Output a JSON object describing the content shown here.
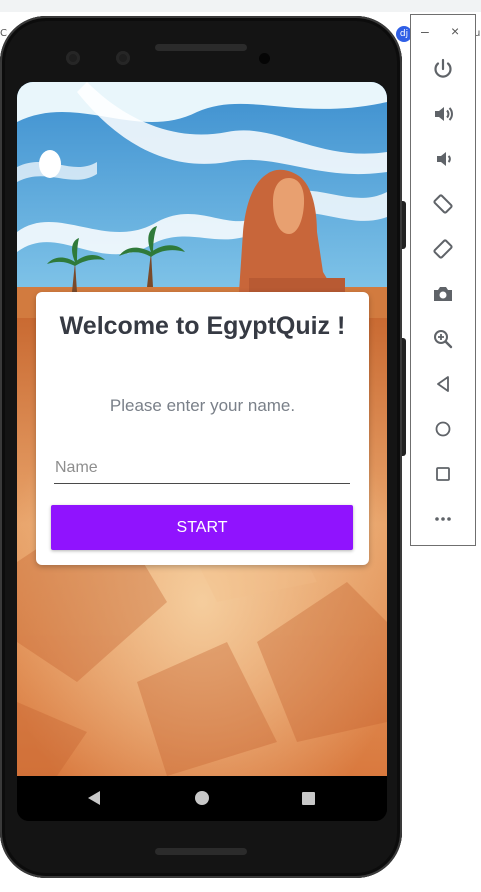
{
  "card": {
    "title": "Welcome to EgyptQuiz !",
    "subtitle": "Please enter your name.",
    "name_placeholder": "Name",
    "start_label": "START"
  },
  "panel": {
    "minimize": "–",
    "close": "×",
    "icons": [
      "power-icon",
      "volume-up-icon",
      "volume-down-icon",
      "rotate-left-icon",
      "rotate-right-icon",
      "camera-icon",
      "zoom-icon",
      "back-icon",
      "home-icon",
      "overview-icon",
      "more-icon"
    ]
  },
  "badge": "dj",
  "edge_left": "C",
  "edge_right": "u",
  "colors": {
    "start_button": "#9013FE",
    "title_text": "#363A43",
    "subtitle_text": "#7A8089"
  }
}
